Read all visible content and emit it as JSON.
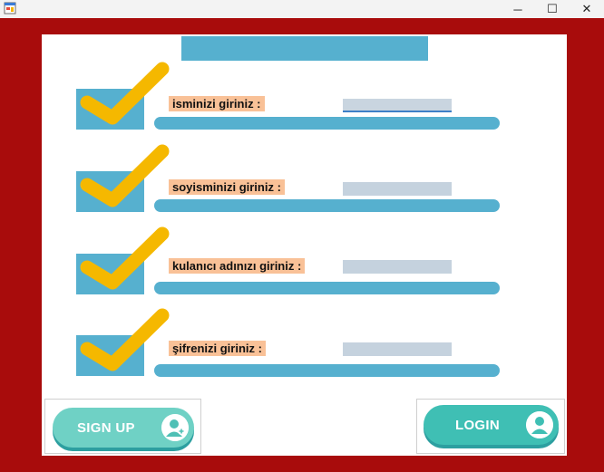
{
  "window": {
    "icons": {
      "app": "app-form-icon",
      "minimize": "minimize-icon",
      "maximize": "maximize-icon",
      "close": "close-icon"
    },
    "minimize_glyph": "─",
    "maximize_glyph": "☐",
    "close_glyph": "✕"
  },
  "colors": {
    "frame": "#a80c0c",
    "panel": "#ffffff",
    "accent_blue": "#56b0cf",
    "label_bg": "#f9c197",
    "check": "#f5b800",
    "button_teal": "#3fbfb4"
  },
  "form": {
    "rows": [
      {
        "label": "isminizi giriniz :",
        "value": ""
      },
      {
        "label": "soyisminizi giriniz :",
        "value": ""
      },
      {
        "label": "kulanıcı adınızı giriniz :",
        "value": ""
      },
      {
        "label": "şifrenizi giriniz :",
        "value": ""
      }
    ]
  },
  "buttons": {
    "signup_label": "SIGN UP",
    "login_label": "LOGIN",
    "signup_icon": "user-icon",
    "login_icon": "user-icon"
  }
}
